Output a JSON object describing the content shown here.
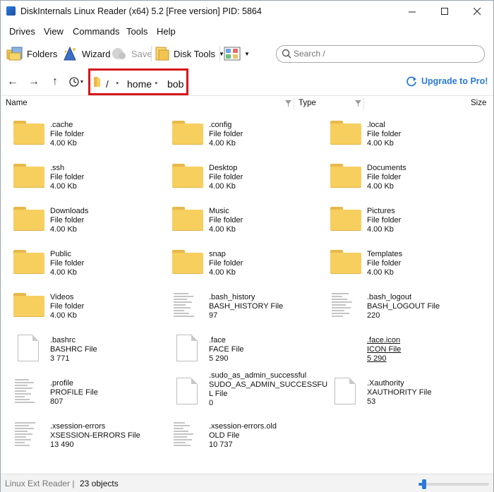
{
  "window": {
    "title": "DiskInternals Linux Reader (x64) 5.2 [Free version] PID: 5864"
  },
  "menu": [
    "Drives",
    "View",
    "Commands",
    "Tools",
    "Help"
  ],
  "toolbar": {
    "folders": "Folders",
    "wizard": "Wizard",
    "save": "Save",
    "disk_tools": "Disk Tools"
  },
  "search": {
    "placeholder": "Search /"
  },
  "breadcrumb": {
    "root": "/",
    "home": "home",
    "user": "bob"
  },
  "upgrade": "Upgrade to Pro!",
  "columns": {
    "name": "Name",
    "type": "Type",
    "size": "Size"
  },
  "files": [
    {
      "name": ".cache",
      "type": "File folder",
      "size": "4.00 Kb",
      "kind": "folder"
    },
    {
      "name": ".config",
      "type": "File folder",
      "size": "4.00 Kb",
      "kind": "folder"
    },
    {
      "name": ".local",
      "type": "File folder",
      "size": "4.00 Kb",
      "kind": "folder"
    },
    {
      "name": ".ssh",
      "type": "File folder",
      "size": "4.00 Kb",
      "kind": "folder"
    },
    {
      "name": "Desktop",
      "type": "File folder",
      "size": "4.00 Kb",
      "kind": "folder"
    },
    {
      "name": "Documents",
      "type": "File folder",
      "size": "4.00 Kb",
      "kind": "folder"
    },
    {
      "name": "Downloads",
      "type": "File folder",
      "size": "4.00 Kb",
      "kind": "folder"
    },
    {
      "name": "Music",
      "type": "File folder",
      "size": "4.00 Kb",
      "kind": "folder"
    },
    {
      "name": "Pictures",
      "type": "File folder",
      "size": "4.00 Kb",
      "kind": "folder"
    },
    {
      "name": "Public",
      "type": "File folder",
      "size": "4.00 Kb",
      "kind": "folder"
    },
    {
      "name": "snap",
      "type": "File folder",
      "size": "4.00 Kb",
      "kind": "folder"
    },
    {
      "name": "Templates",
      "type": "File folder",
      "size": "4.00 Kb",
      "kind": "folder"
    },
    {
      "name": "Videos",
      "type": "File folder",
      "size": "4.00 Kb",
      "kind": "folder"
    },
    {
      "name": ".bash_history",
      "type": "BASH_HISTORY File",
      "size": "97",
      "kind": "text"
    },
    {
      "name": ".bash_logout",
      "type": "BASH_LOGOUT File",
      "size": "220",
      "kind": "text"
    },
    {
      "name": ".bashrc",
      "type": "BASHRC File",
      "size": "3 771",
      "kind": "blank"
    },
    {
      "name": ".face",
      "type": "FACE File",
      "size": "5 290",
      "kind": "blank"
    },
    {
      "name": ".face.icon",
      "type": "ICON File",
      "size": "5 290",
      "kind": "none"
    },
    {
      "name": ".profile",
      "type": "PROFILE File",
      "size": "807",
      "kind": "text"
    },
    {
      "name": ".sudo_as_admin_successful",
      "type": "SUDO_AS_ADMIN_SUCCESSFU",
      "type2": "L File",
      "size": "0",
      "kind": "blank"
    },
    {
      "name": ".Xauthority",
      "type": "XAUTHORITY File",
      "size": "53",
      "kind": "blank"
    },
    {
      "name": ".xsession-errors",
      "type": "XSESSION-ERRORS File",
      "size": "13 490",
      "kind": "text"
    },
    {
      "name": ".xsession-errors.old",
      "type": "OLD File",
      "size": "10 737",
      "kind": "text"
    }
  ],
  "status": {
    "left": "Linux Ext Reader |",
    "count": "23 objects",
    "zoom": 0.08
  }
}
